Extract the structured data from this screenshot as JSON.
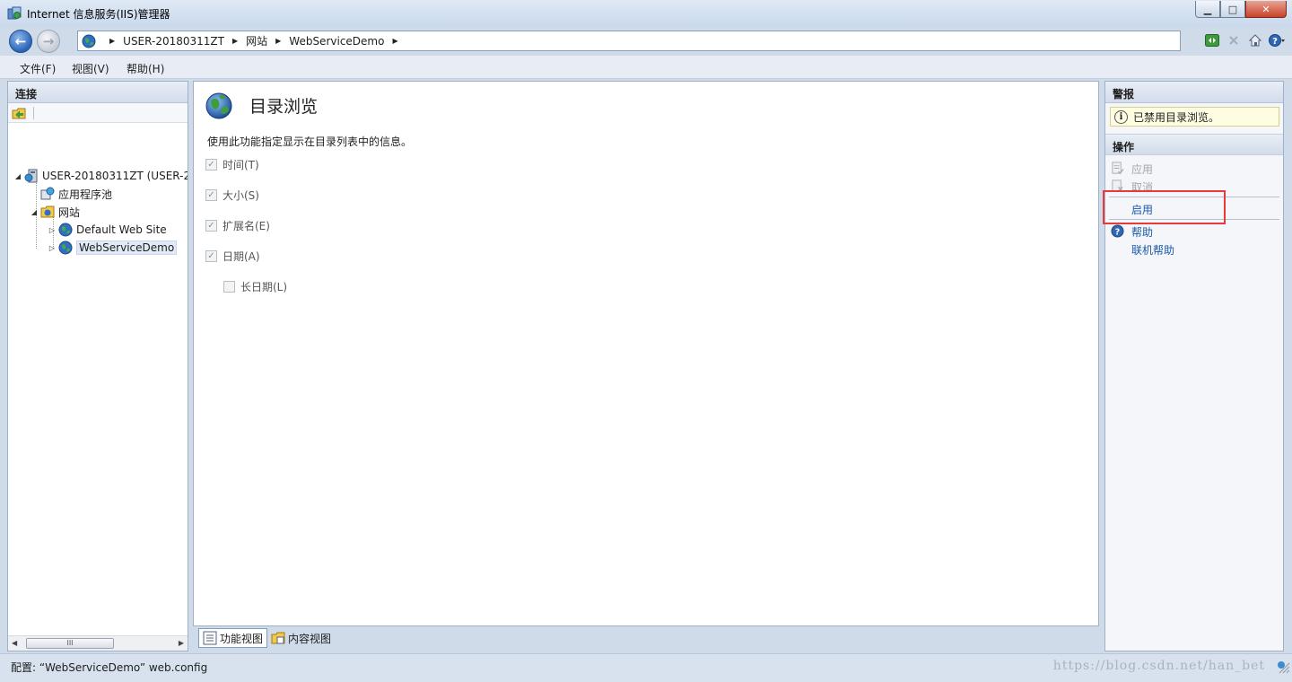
{
  "window": {
    "title": "Internet 信息服务(IIS)管理器",
    "btn_min": "▁",
    "btn_max": "□",
    "btn_close": "✕"
  },
  "address": {
    "crumbs": [
      "USER-20180311ZT",
      "网站",
      "WebServiceDemo"
    ]
  },
  "menu": {
    "items": [
      "文件(F)",
      "视图(V)",
      "帮助(H)"
    ]
  },
  "connections": {
    "title": "连接",
    "tree": {
      "server": "USER-20180311ZT (USER-2",
      "app_pools": "应用程序池",
      "sites": "网站",
      "default_site": "Default Web Site",
      "selected_site": "WebServiceDemo"
    },
    "scrollbar_grip": "III"
  },
  "feature": {
    "title": "目录浏览",
    "description": "使用此功能指定显示在目录列表中的信息。",
    "options": [
      {
        "label": "时间(T)",
        "checked": true
      },
      {
        "label": "大小(S)",
        "checked": true
      },
      {
        "label": "扩展名(E)",
        "checked": true
      },
      {
        "label": "日期(A)",
        "checked": true
      },
      {
        "label": "长日期(L)",
        "checked": false
      }
    ]
  },
  "view_tabs": {
    "features": "功能视图",
    "content": "内容视图"
  },
  "alerts": {
    "title": "警报",
    "message": "已禁用目录浏览。"
  },
  "actions": {
    "title": "操作",
    "apply": "应用",
    "cancel": "取消",
    "enable": "启用",
    "help": "帮助",
    "online_help": "联机帮助"
  },
  "status": {
    "text": "配置: “WebServiceDemo” web.config",
    "watermark": "https://blog.csdn.net/han_bet"
  },
  "colors": {
    "accent_link": "#1a5aa8",
    "highlight_box": "#e83a3a"
  },
  "icons": [
    "iis-manager-icon",
    "back-arrow-icon",
    "forward-arrow-icon",
    "globe-icon",
    "refresh-icon",
    "stop-icon",
    "home-icon",
    "help-icon",
    "server-icon",
    "app-pool-icon",
    "sites-folder-icon",
    "info-icon",
    "apply-icon",
    "cancel-icon",
    "features-view-icon",
    "content-view-icon",
    "resize-grip-icon"
  ]
}
